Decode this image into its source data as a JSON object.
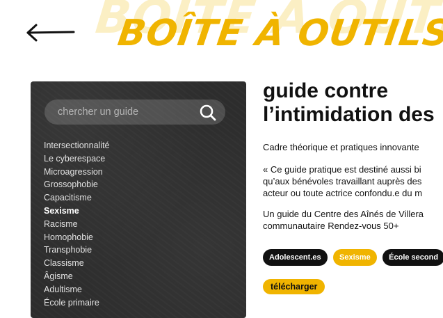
{
  "header": {
    "ghost_title": "BOÎTE À OUTILS",
    "title": "BOÎTE À OUTILS",
    "back_icon": "arrow-left-icon"
  },
  "sidebar": {
    "search_placeholder": "chercher un guide",
    "search_icon": "search-icon",
    "topics": [
      "Intersectionnalité",
      "Le cyberespace",
      "Microagression",
      "Grossophobie",
      "Capacitisme",
      "Sexisme",
      "Racisme",
      "Homophobie",
      "Transphobie",
      "Classisme",
      "Âgisme",
      "Adultisme",
      "École primaire"
    ],
    "active_topic": "Sexisme"
  },
  "guide": {
    "title_line1": "guide contre",
    "title_line2": "l’intimidation des",
    "subtitle": "Cadre théorique et pratiques innovante",
    "quote_line1": "« Ce guide pratique est destiné aussi bi",
    "quote_line2": "qu’aux bénévoles travaillant auprès des",
    "quote_line3": "acteur ou toute actrice confondu.e du m",
    "source_line1": "Un guide du Centre des Aînés de Villera",
    "source_line2": "communautaire Rendez-vous 50+",
    "tags": [
      "Adolescent.es",
      "Sexisme",
      "École second"
    ],
    "download_label": "télécharger"
  },
  "colors": {
    "accent": "#f0b400",
    "ghost": "#fbefc4",
    "sidebar_bg": "#2d2d2d",
    "text": "#111111"
  }
}
